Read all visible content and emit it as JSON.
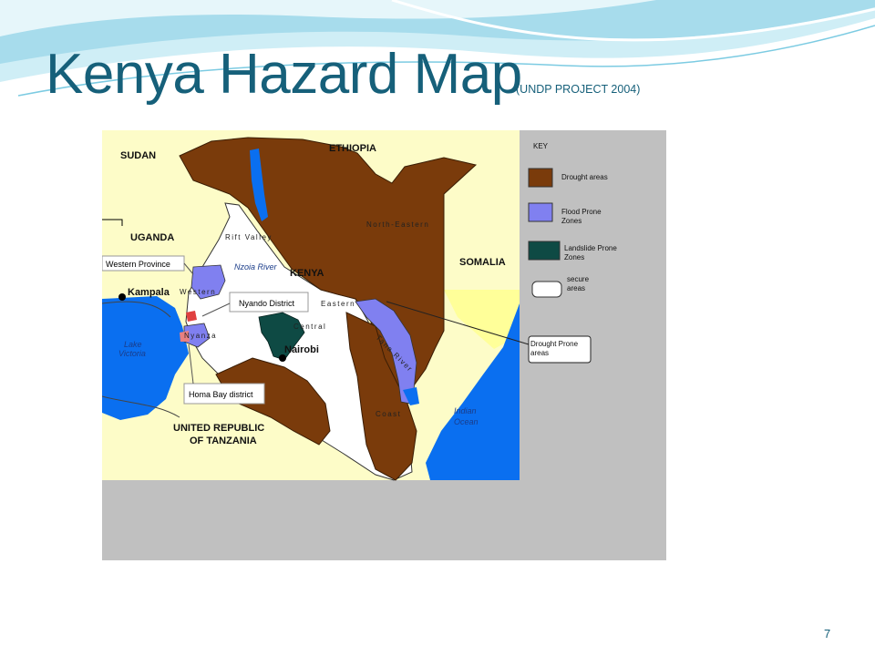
{
  "slide": {
    "title": "Kenya Hazard Map",
    "subtitle": "(UNDP PROJECT 2004)",
    "page_number": "7"
  },
  "colors": {
    "title": "#16607a",
    "drought": "#7a3b0b",
    "flood": "#8080f0",
    "landslide": "#0e4a44",
    "secure": "#ffffff",
    "land": "#fdfcc8",
    "ocean": "#0a6ff0",
    "frame": "#c0c0c0"
  },
  "map": {
    "countries": {
      "sudan": "SUDAN",
      "ethiopia": "ETHIOPIA",
      "uganda": "UGANDA",
      "somalia": "SOMALIA",
      "kenya": "KENYA",
      "tanzania_line1": "UNITED REPUBLIC",
      "tanzania_line2": "OF TANZANIA"
    },
    "cities": {
      "kampala": "Kampala",
      "nairobi": "Nairobi"
    },
    "water": {
      "lake_victoria_line1": "Lake",
      "lake_victoria_line2": "Victoria",
      "indian_ocean_line1": "Indian",
      "indian_ocean_line2": "Ocean",
      "nzoia_river": "Nzoia River"
    },
    "provinces": {
      "rift_valley": "Rift Valley",
      "north_eastern": "North-Eastern",
      "western": "Western",
      "nyanza": "Nyanza",
      "central": "Central",
      "eastern": "Eastern",
      "coast": "Coast",
      "tana_river": "Tana River"
    },
    "callouts": {
      "western_province": "Western Province",
      "nyando_district": "Nyando District",
      "homa_bay_district": "Homa Bay district",
      "drought_prone_line1": "Drought Prone",
      "drought_prone_line2": "areas"
    }
  },
  "legend": {
    "title": "KEY",
    "items": [
      {
        "id": "drought",
        "line1": "Drought areas",
        "line2": ""
      },
      {
        "id": "flood",
        "line1": "Flood Prone",
        "line2": "Zones"
      },
      {
        "id": "landslide",
        "line1": "Landslide Prone",
        "line2": "Zones"
      },
      {
        "id": "secure",
        "line1": "secure",
        "line2": "areas"
      }
    ]
  }
}
